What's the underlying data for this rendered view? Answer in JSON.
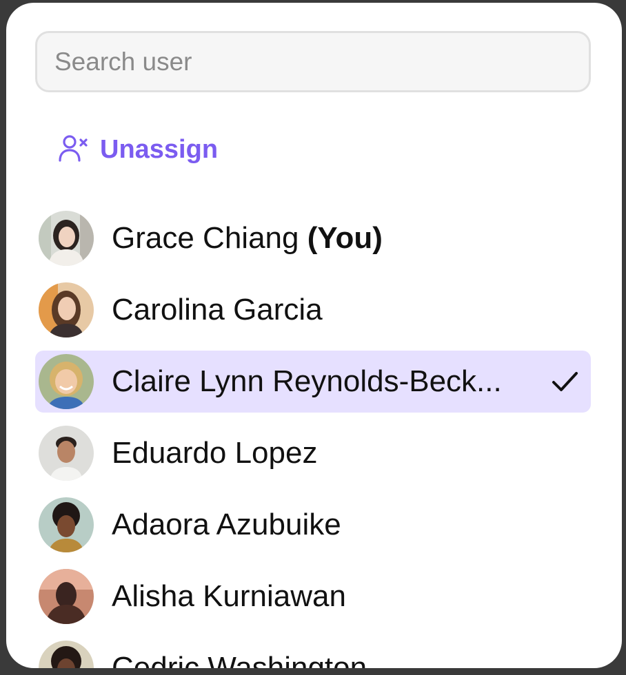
{
  "search": {
    "placeholder": "Search user",
    "value": ""
  },
  "unassign": {
    "label": "Unassign",
    "icon": "user-x-icon",
    "color": "#7b5cf0"
  },
  "selected_highlight": "#e6e0ff",
  "users": [
    {
      "name": "Grace Chiang",
      "suffix": "(You)",
      "selected": false
    },
    {
      "name": "Carolina Garcia",
      "suffix": "",
      "selected": false
    },
    {
      "name": "Claire Lynn Reynolds-Beck...",
      "suffix": "",
      "selected": true,
      "icon": "check-icon"
    },
    {
      "name": "Eduardo Lopez",
      "suffix": "",
      "selected": false
    },
    {
      "name": "Adaora Azubuike",
      "suffix": "",
      "selected": false
    },
    {
      "name": "Alisha Kurniawan",
      "suffix": "",
      "selected": false
    },
    {
      "name": "Cedric Washington",
      "suffix": "",
      "selected": false
    }
  ]
}
